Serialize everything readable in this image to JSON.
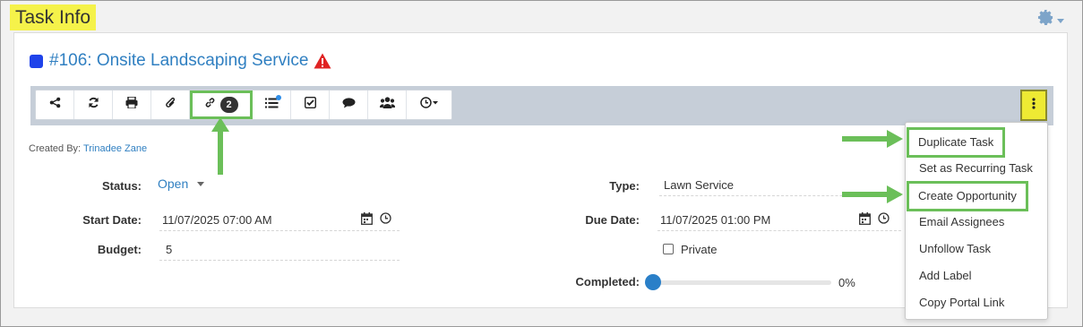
{
  "page": {
    "title": "Task Info"
  },
  "task": {
    "title": "#106: Onsite Landscaping Service"
  },
  "toolbar": {
    "links_count": "2"
  },
  "created": {
    "label": "Created By:",
    "name": "Trinadee Zane"
  },
  "fields": {
    "status_label": "Status:",
    "status_value": "Open",
    "start_label": "Start Date:",
    "start_value": "11/07/2025 07:00 AM",
    "budget_label": "Budget:",
    "budget_value": "5",
    "type_label": "Type:",
    "type_value": "Lawn Service",
    "due_label": "Due Date:",
    "due_value": "11/07/2025 01:00 PM",
    "private_label": "Private",
    "completed_label": "Completed:",
    "completed_value": "0%"
  },
  "completed_fraction": 0,
  "menu": {
    "items": [
      "Duplicate Task",
      "Set as Recurring Task",
      "Create Opportunity",
      "Email Assignees",
      "Unfollow Task",
      "Add Label",
      "Copy Portal Link"
    ]
  },
  "colors": {
    "highlight": "#f5f24a",
    "accent_green": "#6bbf59",
    "link_blue": "#2f7fc1",
    "thumb": "#2a7fc8"
  },
  "icons": [
    "share-icon",
    "refresh-icon",
    "print-icon",
    "attachment-icon",
    "link-icon",
    "list-icon",
    "checkbox-icon",
    "comments-icon",
    "users-icon",
    "clock-icon",
    "gear-icon",
    "warning-icon",
    "kebab-icon",
    "calendar-icon"
  ]
}
